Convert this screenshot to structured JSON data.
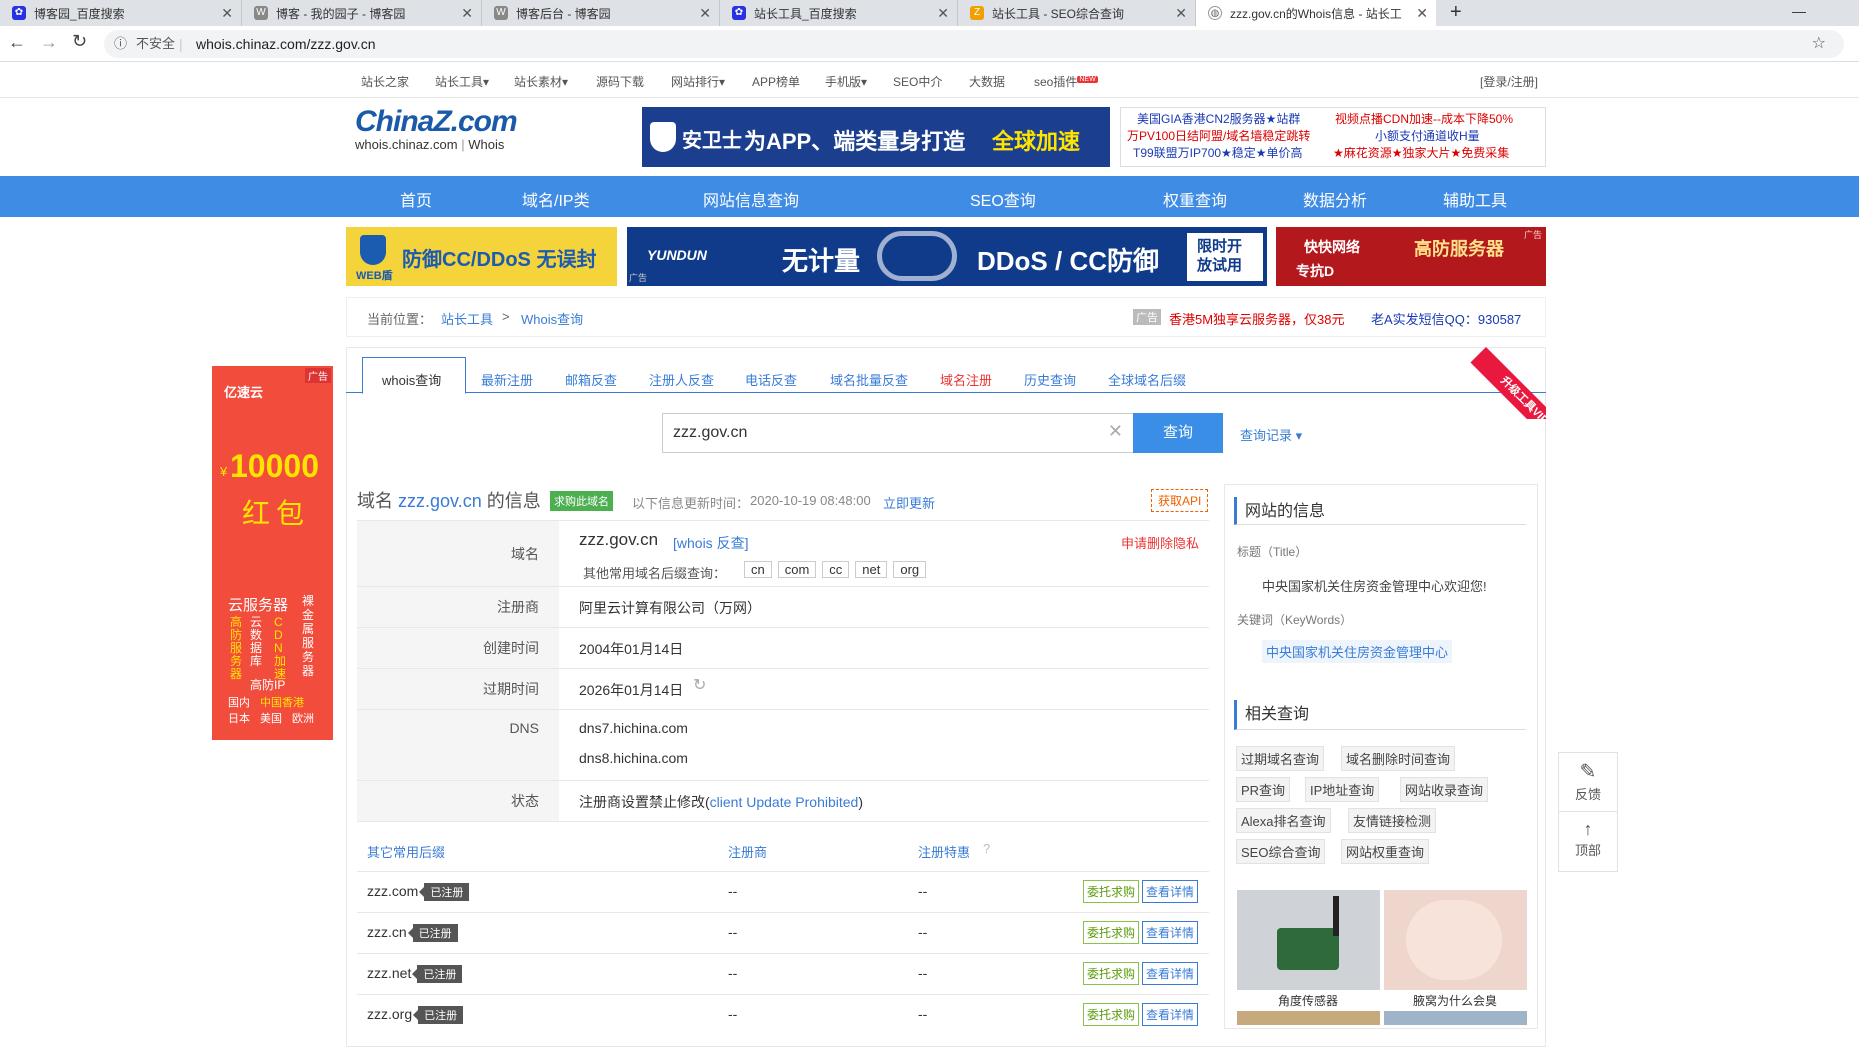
{
  "browser": {
    "tabs": [
      {
        "title": "博客园_百度搜索"
      },
      {
        "title": "博客 - 我的园子 - 博客园"
      },
      {
        "title": "博客后台 - 博客园"
      },
      {
        "title": "站长工具_百度搜索"
      },
      {
        "title": "站长工具 - SEO综合查询"
      },
      {
        "title": "zzz.gov.cn的Whois信息 - 站长工"
      }
    ],
    "insecure_label": "不安全",
    "url": "whois.chinaz.com/zzz.gov.cn"
  },
  "topnav": {
    "items": [
      "站长之家",
      "站长工具",
      "站长素材",
      "源码下载",
      "网站排行",
      "APP榜单",
      "手机版",
      "SEO中介",
      "大数据",
      "seo插件"
    ],
    "new_badge": "NEW",
    "login": "[登录/注册]"
  },
  "logo": {
    "brand": "ChinaZ.com",
    "sub": "whois.chinaz.com",
    "sub2": "Whois"
  },
  "banner_ad": {
    "brand": "安卫士",
    "text": "为APP、端类量身打造",
    "highlight": "全球加速"
  },
  "text_ads": [
    "美国GIA香港CN2服务器★站群",
    "视频点播CDN加速--成本下降50%",
    "万PV100日结阿盟/域名墙稳定跳转",
    "小额支付通道收H量",
    "T99联盟万IP700★稳定★单价高",
    "★麻花资源★独家大片★免费采集"
  ],
  "mainnav": [
    "首页",
    "域名/IP类",
    "网站信息查询",
    "SEO查询",
    "权重查询",
    "数据分析",
    "辅助工具"
  ],
  "ads_row": {
    "ad1": "防御CC/DDoS 无误封",
    "ad1_sub": "WEB盾",
    "ad2_brand": "YUNDUN",
    "ad2_a": "无计量",
    "ad2_b": "DDoS / CC防御",
    "ad2_c": "限时开放试用",
    "ad3_brand": "快快网络",
    "ad3_a": "高防服务器",
    "ad3_b": "专抗D",
    "ad_label": "广告"
  },
  "breadcrumb": {
    "label": "当前位置：",
    "link1": "站长工具",
    "sep": ">",
    "link2": "Whois查询",
    "ad_label": "广告",
    "ad_text": "香港5M独享云服务器，仅38元",
    "qq_text": "老A实发短信QQ：930587"
  },
  "left_ad": {
    "brand": "亿速云",
    "label": "广告",
    "currency": "¥",
    "amount": "10000",
    "unit": "红包",
    "title": "云服务器",
    "col1": "高防服务器",
    "col2": "云数据库",
    "col3": "CDN加速",
    "col4": "高防IP",
    "col5": "裸金属服务器",
    "regions": [
      "国内",
      "中国香港",
      "日本",
      "美国",
      "欧洲"
    ]
  },
  "query_tabs": [
    "whois查询",
    "最新注册",
    "邮箱反查",
    "注册人反查",
    "电话反查",
    "域名批量反查",
    "域名注册",
    "历史查询",
    "全球域名后缀"
  ],
  "vip_ribbon": "升级工具VIP",
  "search": {
    "value": "zzz.gov.cn",
    "button": "查询",
    "history": "查询记录"
  },
  "info_header": {
    "prefix": "域名",
    "domain": "zzz.gov.cn",
    "suffix": "的信息",
    "buy": "求购此域名",
    "updated_label": "以下信息更新时间：",
    "updated_time": "2020-10-19 08:48:00",
    "refresh": "立即更新",
    "api": "获取API"
  },
  "whois": {
    "domain_label": "域名",
    "domain_value": "zzz.gov.cn",
    "reverse": "[whois 反查]",
    "privacy": "申请删除隐私",
    "other_sfx_label": "其他常用域名后缀查询：",
    "other_sfx": [
      "cn",
      "com",
      "cc",
      "net",
      "org"
    ],
    "registrar_label": "注册商",
    "registrar": "阿里云计算有限公司（万网）",
    "created_label": "创建时间",
    "created": "2004年01月14日",
    "expire_label": "过期时间",
    "expire": "2026年01月14日",
    "dns_label": "DNS",
    "dns1": "dns7.hichina.com",
    "dns2": "dns8.hichina.com",
    "status_label": "状态",
    "status_prefix": "注册商设置禁止修改(",
    "status_en": "client Update Prohibited",
    "status_suffix": ")"
  },
  "suffix_table": {
    "headers": [
      "其它常用后缀",
      "注册商",
      "注册特惠"
    ],
    "registered": "已注册",
    "entrust": "委托求购",
    "detail": "查看详情",
    "rows": [
      {
        "domain": "zzz.com",
        "registrar": "--",
        "promo": "--"
      },
      {
        "domain": "zzz.cn",
        "registrar": "--",
        "promo": "--"
      },
      {
        "domain": "zzz.net",
        "registrar": "--",
        "promo": "--"
      },
      {
        "domain": "zzz.org",
        "registrar": "--",
        "promo": "--"
      }
    ]
  },
  "sidebar": {
    "site_info_title": "网站的信息",
    "title_label": "标题（Title）",
    "title_value": "中央国家机关住房资金管理中心欢迎您!",
    "kw_label": "关键词（KeyWords）",
    "kw_value": "中央国家机关住房资金管理中心",
    "related_title": "相关查询",
    "related": [
      "过期域名查询",
      "域名删除时间查询",
      "PR查询",
      "IP地址查询",
      "网站收录查询",
      "Alexa排名查询",
      "友情链接检测",
      "SEO综合查询",
      "网站权重查询"
    ],
    "thumbs": [
      "角度传感器",
      "腋窝为什么会臭"
    ]
  },
  "float_tools": {
    "feedback": "反馈",
    "top": "顶部"
  }
}
